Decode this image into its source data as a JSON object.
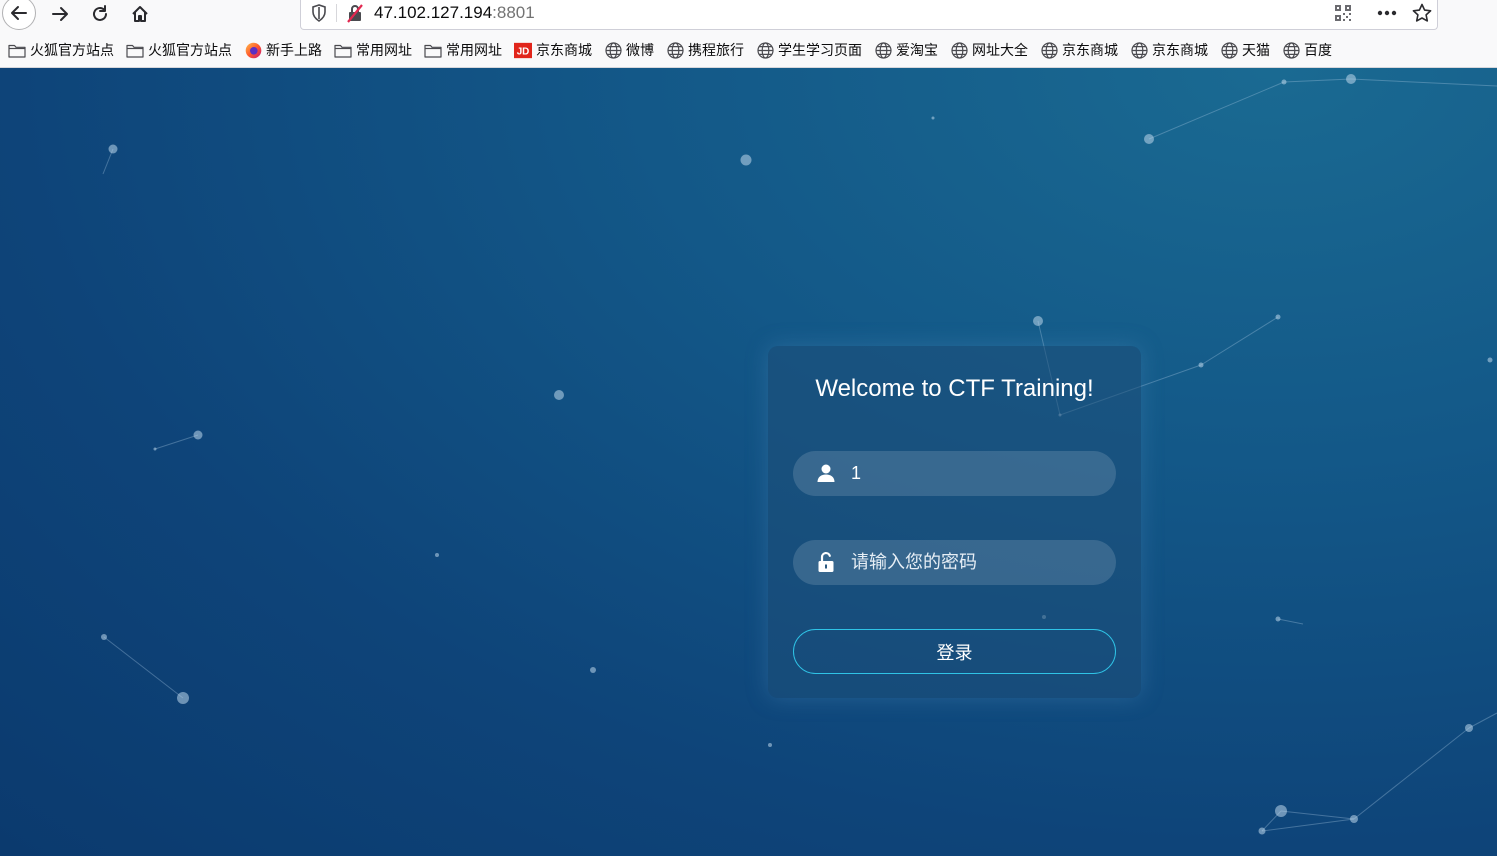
{
  "browser": {
    "url_host": "47.102.127.194",
    "url_port": ":8801",
    "icons": {
      "back": "arrow-left-icon",
      "forward": "arrow-right-icon",
      "reload": "reload-icon",
      "home": "home-icon",
      "tracking": "shield-icon",
      "insecure": "insecure-lock-icon",
      "qr": "qr-code-icon",
      "menu": "more-icon",
      "bookmark": "star-icon"
    }
  },
  "bookmarks": [
    {
      "label": "火狐官方站点",
      "icon": "folder-icon"
    },
    {
      "label": "火狐官方站点",
      "icon": "folder-icon"
    },
    {
      "label": "新手上路",
      "icon": "firefox-icon"
    },
    {
      "label": "常用网址",
      "icon": "folder-icon"
    },
    {
      "label": "常用网址",
      "icon": "folder-icon"
    },
    {
      "label": "京东商城",
      "icon": "jd-icon"
    },
    {
      "label": "微博",
      "icon": "globe-icon"
    },
    {
      "label": "携程旅行",
      "icon": "globe-icon"
    },
    {
      "label": "学生学习页面",
      "icon": "globe-icon"
    },
    {
      "label": "爱淘宝",
      "icon": "globe-icon"
    },
    {
      "label": "网址大全",
      "icon": "globe-icon"
    },
    {
      "label": "京东商城",
      "icon": "globe-icon"
    },
    {
      "label": "京东商城",
      "icon": "globe-icon"
    },
    {
      "label": "天猫",
      "icon": "globe-icon"
    },
    {
      "label": "百度",
      "icon": "globe-icon"
    }
  ],
  "login": {
    "title": "Welcome to CTF Training!",
    "username_value": "1",
    "password_placeholder": "请输入您的密码",
    "submit_label": "登录"
  },
  "colors": {
    "bg_dark": "#0b3a6e",
    "bg_light": "#1a6a92",
    "button_border": "#2fc3e6"
  }
}
